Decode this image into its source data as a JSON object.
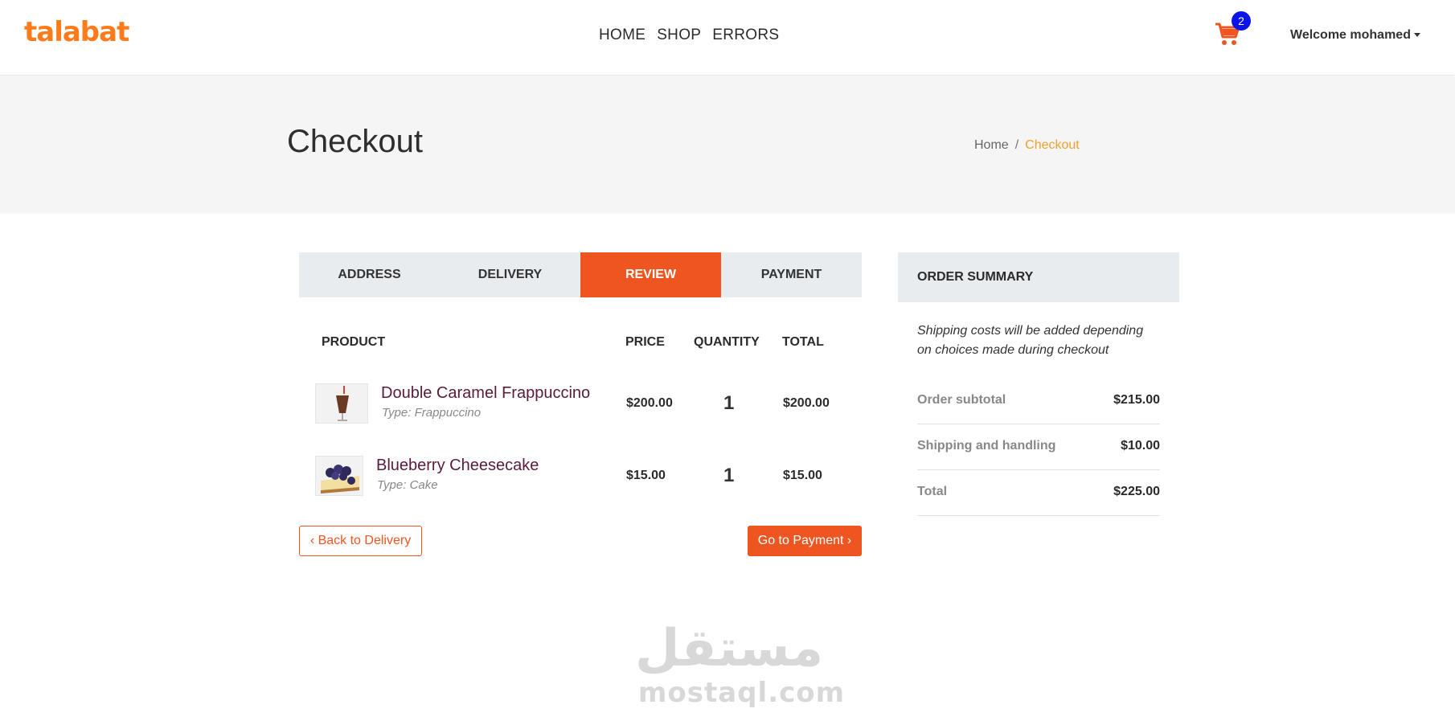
{
  "navbar": {
    "logo": "talabat",
    "links": [
      "HOME",
      "SHOP",
      "ERRORS"
    ],
    "cart_count": "2",
    "user_greeting": "Welcome mohamed"
  },
  "page_header": {
    "title": "Checkout",
    "breadcrumb": [
      "Home",
      "/",
      "Checkout"
    ]
  },
  "steps": [
    "ADDRESS",
    "DELIVERY",
    "REVIEW",
    "PAYMENT"
  ],
  "active_step": "REVIEW",
  "table": {
    "headers": [
      "PRODUCT",
      "PRICE",
      "QUANTITY",
      "TOTAL"
    ],
    "items": [
      {
        "name": "Double Caramel Frappuccino",
        "type": "Type: Frappuccino",
        "price": "$200.00",
        "quantity": "1",
        "total": "$200.00"
      },
      {
        "name": "Blueberry Cheesecake",
        "type": "Type: Cake",
        "price": "$15.00",
        "quantity": "1",
        "total": "$15.00"
      }
    ]
  },
  "actions": {
    "back_label": "Back to Delivery",
    "next_label": "Go to Payment"
  },
  "summary": {
    "title": "ORDER SUMMARY",
    "note": "Shipping costs will be added depending on choices made during checkout",
    "rows": [
      {
        "label": "Order subtotal",
        "value": "$215.00"
      },
      {
        "label": "Shipping and handling",
        "value": "$10.00"
      },
      {
        "label": "Total",
        "value": "$225.00"
      }
    ]
  },
  "watermark": {
    "arabic": "مستقل",
    "latin": "mostaql.com"
  },
  "colors": {
    "brand": "#ff7a1a",
    "accent": "#ee5520",
    "badge": "#0a14e8",
    "breadcrumb_active": "#f0a030",
    "product_name": "#5a1b3a"
  }
}
